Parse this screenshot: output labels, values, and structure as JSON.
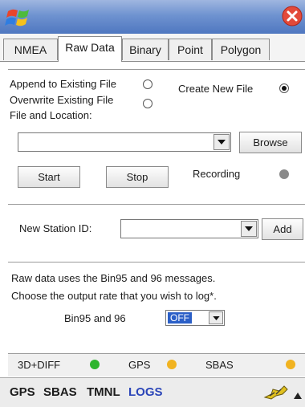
{
  "tabs": [
    {
      "label": "NMEA"
    },
    {
      "label": "Raw Data"
    },
    {
      "label": "Binary"
    },
    {
      "label": "Point"
    },
    {
      "label": "Polygon"
    }
  ],
  "file": {
    "append_label": "Append to Existing File",
    "create_label": "Create New File",
    "overwrite_label": "Overwrite Existing File",
    "location_label": "File and Location:",
    "location_value": "",
    "browse_label": "Browse",
    "start_label": "Start",
    "stop_label": "Stop",
    "recording_label": "Recording",
    "selected_option": "Create New File"
  },
  "station": {
    "label": "New Station ID:",
    "value": "",
    "add_label": "Add"
  },
  "rate": {
    "info_line1": "Raw data uses the Bin95 and 96 messages.",
    "info_line2": "Choose the output rate that you wish to log*.",
    "setting_label": "Bin95 and 96",
    "setting_value": "OFF"
  },
  "status": {
    "fix_label": "3D+DIFF",
    "gps_label": "GPS",
    "sbas_label": "SBAS",
    "colors": {
      "fix": "#2db52d",
      "gps": "#f1b321",
      "sbas": "#f1b321",
      "recording": "#8a8a8a"
    }
  },
  "taskbar": {
    "gps": "GPS",
    "sbas": "SBAS",
    "tmnl": "TMNL",
    "logs": "LOGS"
  }
}
